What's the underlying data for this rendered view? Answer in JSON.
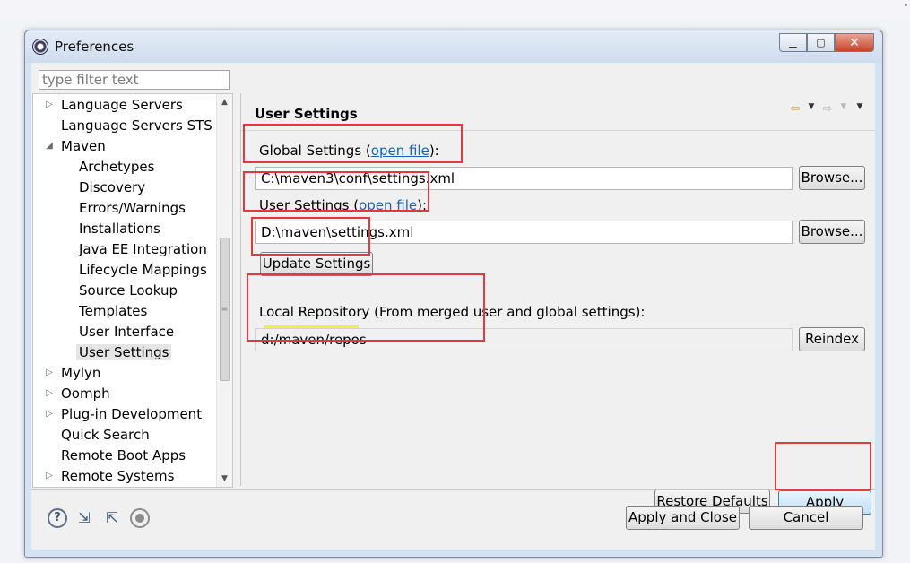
{
  "window": {
    "title": "Preferences"
  },
  "titlebar_buttons": {
    "minimize": "▁",
    "maximize": "▢",
    "close": "✕"
  },
  "filter": {
    "placeholder": "type filter text",
    "value": ""
  },
  "tree": {
    "items": [
      {
        "label": "Language Servers",
        "indent": 0,
        "arrow": "▷"
      },
      {
        "label": "Language Servers STS",
        "indent": 0,
        "arrow": ""
      },
      {
        "label": "Maven",
        "indent": 0,
        "arrow": "◢"
      },
      {
        "label": "Archetypes",
        "indent": 1,
        "arrow": ""
      },
      {
        "label": "Discovery",
        "indent": 1,
        "arrow": ""
      },
      {
        "label": "Errors/Warnings",
        "indent": 1,
        "arrow": ""
      },
      {
        "label": "Installations",
        "indent": 1,
        "arrow": ""
      },
      {
        "label": "Java EE Integration",
        "indent": 1,
        "arrow": ""
      },
      {
        "label": "Lifecycle Mappings",
        "indent": 1,
        "arrow": ""
      },
      {
        "label": "Source Lookup",
        "indent": 1,
        "arrow": ""
      },
      {
        "label": "Templates",
        "indent": 1,
        "arrow": ""
      },
      {
        "label": "User Interface",
        "indent": 1,
        "arrow": ""
      },
      {
        "label": "User Settings",
        "indent": 1,
        "arrow": "",
        "selected": true
      },
      {
        "label": "Mylyn",
        "indent": 0,
        "arrow": "▷"
      },
      {
        "label": "Oomph",
        "indent": 0,
        "arrow": "▷"
      },
      {
        "label": "Plug-in Development",
        "indent": 0,
        "arrow": "▷"
      },
      {
        "label": "Quick Search",
        "indent": 0,
        "arrow": ""
      },
      {
        "label": "Remote Boot Apps",
        "indent": 0,
        "arrow": ""
      },
      {
        "label": "Remote Systems",
        "indent": 0,
        "arrow": "▷"
      }
    ]
  },
  "page": {
    "title": "User Settings",
    "nav": {
      "back": "⇦",
      "forward": "⇨",
      "dropdown": "▼",
      "menu": "▼"
    },
    "global": {
      "label": "Global Settings (",
      "link": "open file",
      "suffix": "):",
      "value": "C:\\maven3\\conf\\settings.xml",
      "browse": "Browse..."
    },
    "user": {
      "label": "User Settings (",
      "link": "open file",
      "suffix": "):",
      "value": "D:\\maven\\settings.xml",
      "browse": "Browse..."
    },
    "update_button": "Update Settings",
    "local_repo": {
      "label": "Local Repository (From merged user and global settings):",
      "value": "d:/maven/repos",
      "reindex": "Reindex"
    },
    "restore_defaults": "Restore Defaults",
    "apply": "Apply"
  },
  "footer": {
    "icons": [
      "help-icon",
      "import-icon",
      "export-icon",
      "record-icon"
    ],
    "help_glyph": "?",
    "import_glyph": "⇲",
    "export_glyph": "⇱",
    "apply_close": "Apply and Close",
    "cancel": "Cancel"
  },
  "annotation_colors": {
    "box": "#e0393e",
    "underline": "#f0ef3a"
  }
}
